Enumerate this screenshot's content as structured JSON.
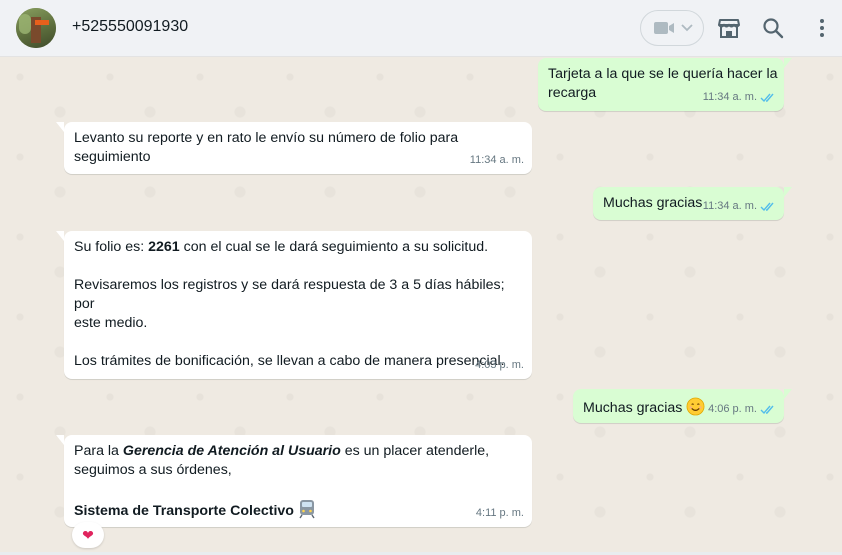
{
  "header": {
    "contact_name": "+525550091930",
    "icons": [
      "avatar",
      "video-call-icon",
      "chevron-down-icon",
      "shop-icon",
      "search-icon",
      "menu-icon"
    ]
  },
  "messages": [
    {
      "dir": "out",
      "lines": [
        "Tarjeta a la que se le quería hacer la",
        "recarga"
      ],
      "time": "11:34 a. m.",
      "status": "read"
    },
    {
      "dir": "in",
      "lines": [
        "Levanto su reporte y en rato le envío su número de folio para",
        "seguimiento"
      ],
      "time": "11:34 a. m."
    },
    {
      "dir": "out",
      "lines": [
        "Muchas gracias"
      ],
      "time": "11:34 a. m.",
      "status": "read"
    },
    {
      "dir": "in",
      "folio_prefix": "Su folio es: ",
      "folio_number": "2261",
      "folio_suffix": " con el cual se le dará seguimiento a su solicitud.",
      "para2": [
        "Revisaremos los registros y se dará respuesta de 3 a 5 días hábiles; por",
        "este medio."
      ],
      "para3": "Los trámites de bonificación, se llevan a cabo de manera presencial.",
      "time": "4:03 p. m."
    },
    {
      "dir": "out",
      "lines": [
        "Muchas gracias"
      ],
      "emoji": "😊",
      "time": "4:06 p. m.",
      "status": "read"
    },
    {
      "dir": "in",
      "line1_prefix": "Para la ",
      "line1_bold": "Gerencia de Atención al Usuario",
      "line1_suffix": " es un placer atenderle,",
      "line2": "seguimos a sus órdenes,",
      "signature": "Sistema de Transporte Colectivo",
      "signature_emoji": "🚆",
      "time": "4:11 p. m.",
      "reaction": "❤"
    }
  ],
  "colors": {
    "outgoing": "#d9fdd3",
    "incoming": "#ffffff",
    "read_ticks": "#53bdeb",
    "background": "#efeae2"
  }
}
